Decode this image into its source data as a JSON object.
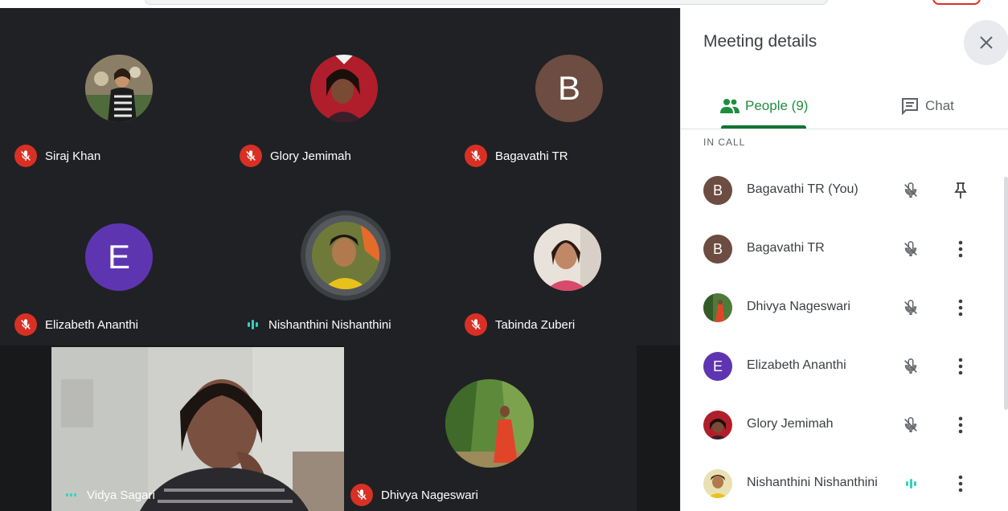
{
  "grid": {
    "tiles": [
      {
        "name": "Siraj Khan",
        "status": "muted",
        "avatar": "photo"
      },
      {
        "name": "Glory Jemimah",
        "status": "muted",
        "avatar": "photo"
      },
      {
        "name": "Bagavathi TR",
        "status": "muted",
        "avatar": "letter",
        "initial": "B",
        "color": "#6d4c41"
      },
      {
        "name": "Elizabeth Ananthi",
        "status": "muted",
        "avatar": "letter",
        "initial": "E",
        "color": "#5e35b1"
      },
      {
        "name": "Nishanthini Nishanthini",
        "status": "speaking",
        "avatar": "photo"
      },
      {
        "name": "Tabinda Zuberi",
        "status": "muted",
        "avatar": "photo"
      },
      {
        "name": "Vidya Sagari",
        "status": "speaking",
        "avatar": "video"
      },
      {
        "name": "Dhivya Nageswari",
        "status": "muted",
        "avatar": "photo"
      }
    ]
  },
  "panel": {
    "title": "Meeting details",
    "tabs": {
      "people": "People (9)",
      "chat": "Chat"
    },
    "section_label": "IN CALL",
    "participants": [
      {
        "name": "Bagavathi TR (You)",
        "initial": "B",
        "color": "#6d4c41",
        "mic": "muted",
        "action": "pin-icon"
      },
      {
        "name": "Bagavathi TR",
        "initial": "B",
        "color": "#6d4c41",
        "mic": "muted",
        "action": "more-icon"
      },
      {
        "name": "Dhivya Nageswari",
        "initial": "",
        "color": "#4e7a3a",
        "mic": "muted",
        "action": "more-icon"
      },
      {
        "name": "Elizabeth Ananthi",
        "initial": "E",
        "color": "#5e35b1",
        "mic": "muted",
        "action": "more-icon"
      },
      {
        "name": "Glory Jemimah",
        "initial": "",
        "color": "#7a2a2a",
        "mic": "muted",
        "action": "more-icon"
      },
      {
        "name": "Nishanthini Nishanthini",
        "initial": "",
        "color": "#b89a3a",
        "mic": "speaking",
        "action": "more-icon"
      }
    ]
  },
  "colors": {
    "accent": "#1e8e3e",
    "muted_badge": "#d93025",
    "speaking": "#34d1bf",
    "grid_bg": "#202124"
  }
}
